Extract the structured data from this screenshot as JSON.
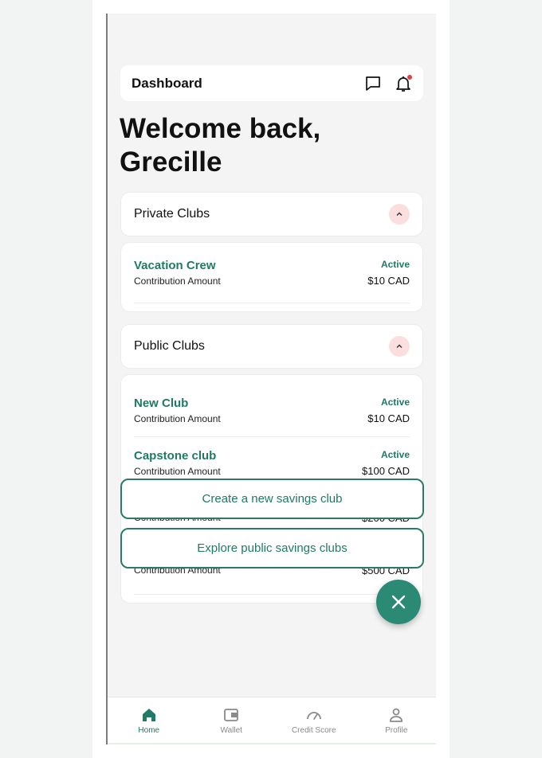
{
  "header": {
    "title": "Dashboard",
    "icons": [
      "chat-icon",
      "bell-icon"
    ],
    "notification_dot_color": "#e0424a"
  },
  "welcome": {
    "line1": "Welcome back,",
    "line2": "Grecille"
  },
  "private_clubs": {
    "title": "Private Clubs",
    "clubs": [
      {
        "name": "Vacation Crew",
        "subtitle": "Contribution Amount",
        "status": "Active",
        "amount": "$10 CAD"
      }
    ]
  },
  "public_clubs": {
    "title": "Public Clubs",
    "clubs": [
      {
        "name": "New Club",
        "subtitle": "Contribution Amount",
        "status": "Active",
        "amount": "$10 CAD"
      },
      {
        "name": "Capstone club",
        "subtitle": "Contribution Amount",
        "status": "Active",
        "amount": "$100 CAD"
      },
      {
        "name": "",
        "subtitle": "Contribution Amount",
        "status": "",
        "amount": "$200 CAD"
      },
      {
        "name": "",
        "subtitle": "Contribution Amount",
        "status": "",
        "amount": "$500 CAD"
      }
    ]
  },
  "actions": {
    "create": "Create a new savings club",
    "explore": "Explore public savings clubs"
  },
  "fab": {
    "icon": "close-icon"
  },
  "nav": [
    {
      "label": "Home",
      "icon": "home-icon",
      "active": true
    },
    {
      "label": "Wallet",
      "icon": "wallet-icon",
      "active": false
    },
    {
      "label": "Credit Score",
      "icon": "gauge-icon",
      "active": false
    },
    {
      "label": "Profile",
      "icon": "user-icon",
      "active": false
    }
  ],
  "colors": {
    "accent": "#1f7a66",
    "fab": "#2a8a73",
    "collapse_bg": "#fbdede"
  }
}
